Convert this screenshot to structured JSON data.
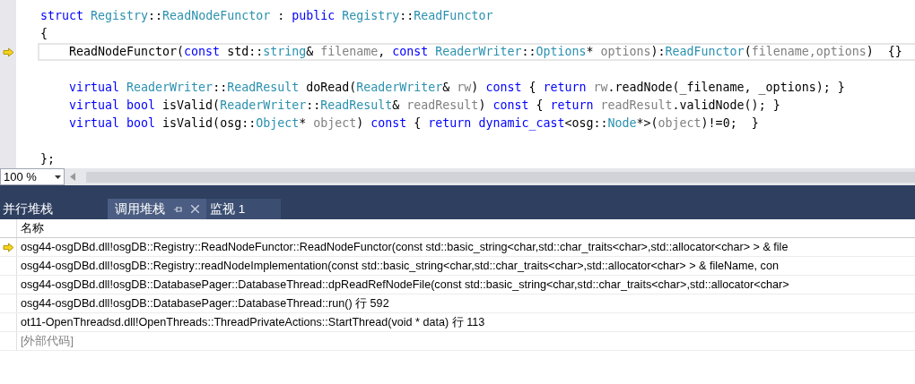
{
  "editor": {
    "lines": [
      {
        "indented": false,
        "gap_before": false,
        "current": false,
        "tokens": [
          {
            "kind": "kw",
            "text": "struct "
          },
          {
            "kind": "type",
            "text": "Registry"
          },
          {
            "kind": "plain",
            "text": "::"
          },
          {
            "kind": "type",
            "text": "ReadNodeFunctor"
          },
          {
            "kind": "plain",
            "text": " : "
          },
          {
            "kind": "kw",
            "text": "public "
          },
          {
            "kind": "type",
            "text": "Registry"
          },
          {
            "kind": "plain",
            "text": "::"
          },
          {
            "kind": "type",
            "text": "ReadFunctor"
          }
        ]
      },
      {
        "indented": false,
        "gap_before": false,
        "current": false,
        "tokens": [
          {
            "kind": "plain",
            "text": "{"
          }
        ]
      },
      {
        "indented": true,
        "gap_before": false,
        "current": true,
        "tokens": [
          {
            "kind": "plain",
            "text": "ReadNodeFunctor("
          },
          {
            "kind": "kw",
            "text": "const"
          },
          {
            "kind": "plain",
            "text": " std::"
          },
          {
            "kind": "type",
            "text": "string"
          },
          {
            "kind": "plain",
            "text": "& "
          },
          {
            "kind": "param",
            "text": "filename"
          },
          {
            "kind": "plain",
            "text": ", "
          },
          {
            "kind": "kw",
            "text": "const "
          },
          {
            "kind": "type",
            "text": "ReaderWriter"
          },
          {
            "kind": "plain",
            "text": "::"
          },
          {
            "kind": "type",
            "text": "Options"
          },
          {
            "kind": "plain",
            "text": "* "
          },
          {
            "kind": "param",
            "text": "options"
          },
          {
            "kind": "plain",
            "text": "):"
          },
          {
            "kind": "type",
            "text": "ReadFunctor"
          },
          {
            "kind": "plain",
            "text": "("
          },
          {
            "kind": "param",
            "text": "filename,options"
          },
          {
            "kind": "plain",
            "text": ")  {}"
          }
        ]
      },
      {
        "indented": true,
        "gap_before": true,
        "current": false,
        "tokens": [
          {
            "kind": "kw",
            "text": "virtual "
          },
          {
            "kind": "type",
            "text": "ReaderWriter"
          },
          {
            "kind": "plain",
            "text": "::"
          },
          {
            "kind": "type",
            "text": "ReadResult"
          },
          {
            "kind": "plain",
            "text": " doRead("
          },
          {
            "kind": "type",
            "text": "ReaderWriter"
          },
          {
            "kind": "plain",
            "text": "& "
          },
          {
            "kind": "param",
            "text": "rw"
          },
          {
            "kind": "plain",
            "text": ") "
          },
          {
            "kind": "kw",
            "text": "const"
          },
          {
            "kind": "plain",
            "text": " { "
          },
          {
            "kind": "kw",
            "text": "return "
          },
          {
            "kind": "param",
            "text": "rw"
          },
          {
            "kind": "plain",
            "text": ".readNode(_filename, _options); }"
          }
        ]
      },
      {
        "indented": true,
        "gap_before": false,
        "current": false,
        "tokens": [
          {
            "kind": "kw",
            "text": "virtual bool"
          },
          {
            "kind": "plain",
            "text": " isValid("
          },
          {
            "kind": "type",
            "text": "ReaderWriter"
          },
          {
            "kind": "plain",
            "text": "::"
          },
          {
            "kind": "type",
            "text": "ReadResult"
          },
          {
            "kind": "plain",
            "text": "& "
          },
          {
            "kind": "param",
            "text": "readResult"
          },
          {
            "kind": "plain",
            "text": ") "
          },
          {
            "kind": "kw",
            "text": "const"
          },
          {
            "kind": "plain",
            "text": " { "
          },
          {
            "kind": "kw",
            "text": "return "
          },
          {
            "kind": "param",
            "text": "readResult"
          },
          {
            "kind": "plain",
            "text": ".validNode(); }"
          }
        ]
      },
      {
        "indented": true,
        "gap_before": false,
        "current": false,
        "tokens": [
          {
            "kind": "kw",
            "text": "virtual bool"
          },
          {
            "kind": "plain",
            "text": " isValid(osg::"
          },
          {
            "kind": "type",
            "text": "Object"
          },
          {
            "kind": "plain",
            "text": "* "
          },
          {
            "kind": "param",
            "text": "object"
          },
          {
            "kind": "plain",
            "text": ") "
          },
          {
            "kind": "kw",
            "text": "const"
          },
          {
            "kind": "plain",
            "text": " { "
          },
          {
            "kind": "kw",
            "text": "return dynamic_cast"
          },
          {
            "kind": "plain",
            "text": "<osg::"
          },
          {
            "kind": "type",
            "text": "Node"
          },
          {
            "kind": "plain",
            "text": "*>("
          },
          {
            "kind": "param",
            "text": "object"
          },
          {
            "kind": "plain",
            "text": ")!=0;  }"
          }
        ]
      },
      {
        "indented": false,
        "gap_before": true,
        "current": false,
        "tokens": [
          {
            "kind": "plain",
            "text": "};"
          }
        ]
      }
    ]
  },
  "zoom": {
    "value": "100 %"
  },
  "tabs": [
    {
      "label": "并行堆栈",
      "selected": false
    },
    {
      "label": "调用堆栈",
      "selected": true
    },
    {
      "label": "监视 1",
      "selected": false
    }
  ],
  "call_stack": {
    "columns": [
      "名称"
    ],
    "rows": [
      {
        "text": "osg44-osgDBd.dll!osgDB::Registry::ReadNodeFunctor::ReadNodeFunctor(const std::basic_string<char,std::char_traits<char>,std::allocator<char> > & file",
        "current": true,
        "external": false
      },
      {
        "text": "osg44-osgDBd.dll!osgDB::Registry::readNodeImplementation(const std::basic_string<char,std::char_traits<char>,std::allocator<char> > & fileName, con",
        "current": false,
        "external": false
      },
      {
        "text": "osg44-osgDBd.dll!osgDB::DatabasePager::DatabaseThread::dpReadRefNodeFile(const std::basic_string<char,std::char_traits<char>,std::allocator<char>",
        "current": false,
        "external": false
      },
      {
        "text": "osg44-osgDBd.dll!osgDB::DatabasePager::DatabaseThread::run() 行 592",
        "current": false,
        "external": false
      },
      {
        "text": "ot11-OpenThreadsd.dll!OpenThreads::ThreadPrivateActions::StartThread(void * data) 行 113",
        "current": false,
        "external": false
      },
      {
        "text": "[外部代码]",
        "current": false,
        "external": true
      }
    ]
  }
}
